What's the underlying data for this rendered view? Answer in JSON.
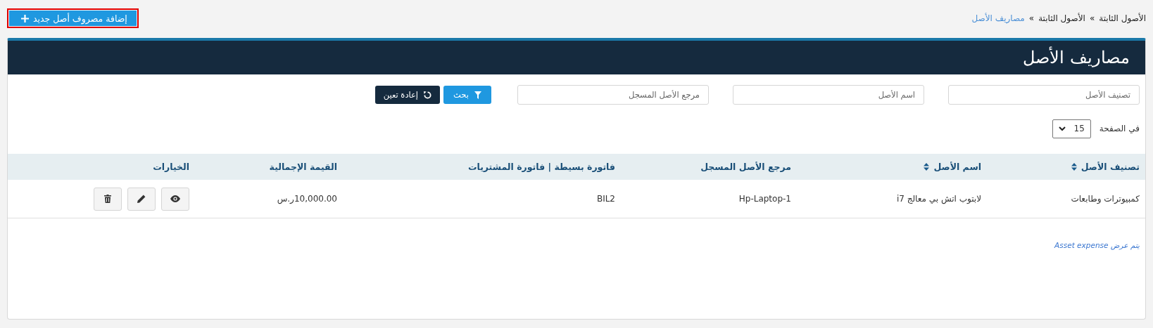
{
  "breadcrumb": [
    {
      "label": "الأصول الثابتة",
      "separator": "»",
      "current": false
    },
    {
      "label": "الأصول الثابتة",
      "separator": "»",
      "current": false
    },
    {
      "label": "مصاريف الأصل",
      "current": true
    }
  ],
  "add_button": {
    "label": "إضافة مصروف أصل جديد",
    "highlighted": true
  },
  "panel": {
    "title": "مصاريف الأصل"
  },
  "filters": {
    "fields": [
      {
        "placeholder": "تصنيف الأصل"
      },
      {
        "placeholder": "اسم الأصل"
      },
      {
        "placeholder": "مرجع الأصل المسجل"
      }
    ],
    "search_button": "بحث",
    "reset_button": "إعادة تعين"
  },
  "page_size": {
    "label": "في الصفحة",
    "value": "15"
  },
  "table": {
    "columns": [
      {
        "label": "تصنيف الأصل",
        "sortable": true
      },
      {
        "label": "اسم الأصل",
        "sortable": true
      },
      {
        "label": "مرجع الأصل المسجل",
        "sortable": false
      },
      {
        "label": "فاتورة بسيطة | فاتورة المشتريات",
        "sortable": false
      },
      {
        "label": "القيمة الإجمالية",
        "sortable": false
      },
      {
        "label": "الخيارات",
        "sortable": false
      }
    ],
    "rows": [
      {
        "cells": [
          "كمبيوترات وطابعات",
          "لابتوب اتش بي معالج i7",
          "Hp-Laptop-1",
          "BIL2",
          "10,000.00ر.س"
        ],
        "actions": [
          {
            "kind": "view"
          },
          {
            "kind": "edit"
          },
          {
            "kind": "delete"
          }
        ]
      }
    ]
  },
  "footer_note": "يتم عرض Asset expense"
}
